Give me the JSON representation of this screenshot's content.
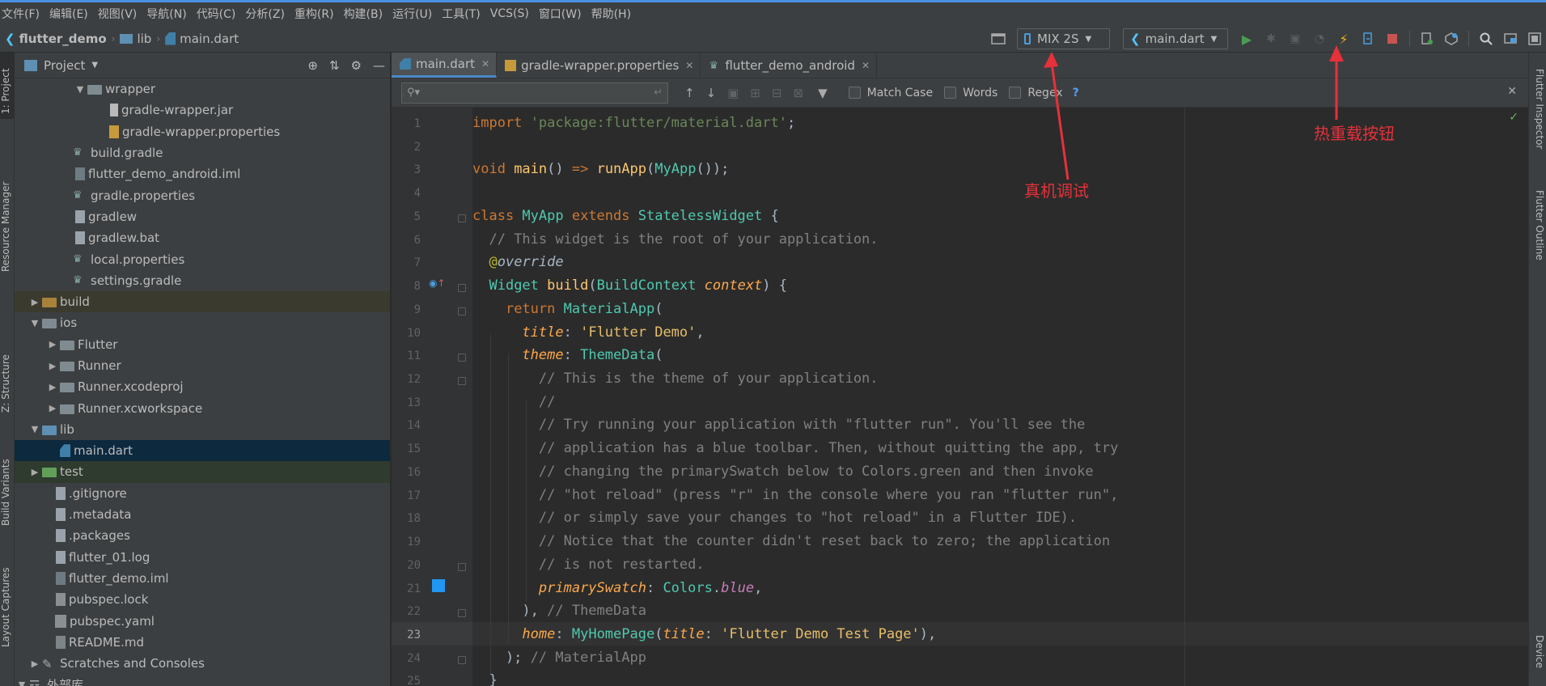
{
  "menu": {
    "items": [
      "文件(F)",
      "编辑(E)",
      "视图(V)",
      "导航(N)",
      "代码(C)",
      "分析(Z)",
      "重构(R)",
      "构建(B)",
      "运行(U)",
      "工具(T)",
      "VCS(S)",
      "窗口(W)",
      "帮助(H)"
    ]
  },
  "breadcrumb": {
    "project": "flutter_demo",
    "folder": "lib",
    "file": "main.dart"
  },
  "toolbar": {
    "device": "MIX 2S",
    "run_config": "main.dart",
    "accent_run": "#499c54",
    "accent_hot_reload": "#f0b31a",
    "accent_stop": "#c75450"
  },
  "left_strip": {
    "project": "1: Project",
    "resource_manager": "Resource Manager",
    "structure": "Z: Structure",
    "build_variants": "Build Variants",
    "layout_captures": "Layout Captures"
  },
  "right_strip": {
    "flutter_inspector": "Flutter Inspector",
    "flutter_outline": "Flutter Outline",
    "device": "Device"
  },
  "project_panel": {
    "title": "Project",
    "tree": [
      {
        "label": "wrapper",
        "type": "folder",
        "expanded": true
      },
      {
        "label": "gradle-wrapper.jar",
        "type": "jar"
      },
      {
        "label": "gradle-wrapper.properties",
        "type": "props"
      },
      {
        "label": "build.gradle",
        "type": "gradle"
      },
      {
        "label": "flutter_demo_android.iml",
        "type": "iml"
      },
      {
        "label": "gradle.properties",
        "type": "gradle"
      },
      {
        "label": "gradlew",
        "type": "file"
      },
      {
        "label": "gradlew.bat",
        "type": "file"
      },
      {
        "label": "local.properties",
        "type": "gradle"
      },
      {
        "label": "settings.gradle",
        "type": "gradle"
      },
      {
        "label": "build",
        "type": "folder",
        "expanded": false
      },
      {
        "label": "ios",
        "type": "folder",
        "expanded": true
      },
      {
        "label": "Flutter",
        "type": "folder",
        "expanded": false
      },
      {
        "label": "Runner",
        "type": "folder",
        "expanded": false
      },
      {
        "label": "Runner.xcodeproj",
        "type": "folder",
        "expanded": false
      },
      {
        "label": "Runner.xcworkspace",
        "type": "folder",
        "expanded": false
      },
      {
        "label": "lib",
        "type": "folder",
        "expanded": true
      },
      {
        "label": "main.dart",
        "type": "dart"
      },
      {
        "label": "test",
        "type": "folder",
        "expanded": false
      },
      {
        "label": ".gitignore",
        "type": "file"
      },
      {
        "label": ".metadata",
        "type": "file"
      },
      {
        "label": ".packages",
        "type": "file"
      },
      {
        "label": "flutter_01.log",
        "type": "file"
      },
      {
        "label": "flutter_demo.iml",
        "type": "iml"
      },
      {
        "label": "pubspec.lock",
        "type": "lock"
      },
      {
        "label": "pubspec.yaml",
        "type": "yaml"
      },
      {
        "label": "README.md",
        "type": "md"
      },
      {
        "label": "Scratches and Consoles",
        "type": "scratch"
      },
      {
        "label": "外部库",
        "type": "lib",
        "expanded": true
      }
    ]
  },
  "tabs": [
    {
      "label": "main.dart",
      "active": true
    },
    {
      "label": "gradle-wrapper.properties",
      "active": false
    },
    {
      "label": "flutter_demo_android",
      "active": false
    }
  ],
  "find": {
    "query": "",
    "match_case": "Match Case",
    "words": "Words",
    "regex": "Regex",
    "help": "?"
  },
  "editor": {
    "line_numbers": [
      "1",
      "2",
      "3",
      "4",
      "5",
      "6",
      "7",
      "8",
      "9",
      "10",
      "11",
      "12",
      "13",
      "14",
      "15",
      "16",
      "17",
      "18",
      "19",
      "20",
      "21",
      "22",
      "23",
      "24",
      "25"
    ],
    "current_line": "23",
    "swatch_color": "#2196f3"
  },
  "annotations": {
    "device_debug": "真机调试",
    "hot_reload": "热重载按钮",
    "color": "#e6313a"
  }
}
